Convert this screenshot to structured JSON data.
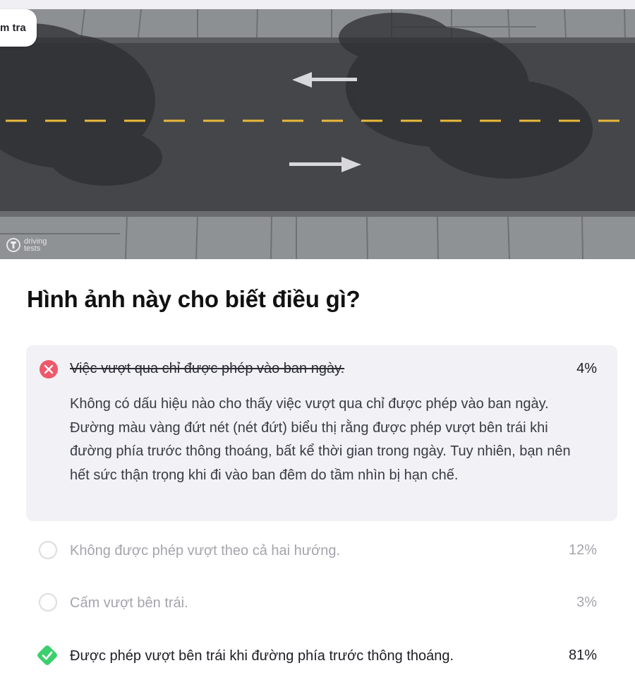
{
  "header": {
    "tab_label": "m tra"
  },
  "illustration": {
    "watermark_line1": "driving",
    "watermark_line2": "tests"
  },
  "question": {
    "text": "Hình ảnh này cho biết điều gì?"
  },
  "options": [
    {
      "label": "Việc vượt qua chỉ được phép vào ban ngày.",
      "percent": "4%",
      "state": "incorrect-selected",
      "icon": "x-circle-icon",
      "explanation": "Không có dấu hiệu nào cho thấy việc vượt qua chỉ được phép vào ban ngày. Đường màu vàng đứt nét (nét đứt) biểu thị rằng được phép vượt bên trái khi đường phía trước thông thoáng, bất kể thời gian trong ngày. Tuy nhiên, bạn nên hết sức thận trọng khi đi vào ban đêm do tầm nhìn bị hạn chế."
    },
    {
      "label": "Không được phép vượt theo cả hai hướng.",
      "percent": "12%",
      "state": "unselected",
      "icon": "radio-empty-icon"
    },
    {
      "label": "Cấm vượt bên trái.",
      "percent": "3%",
      "state": "unselected",
      "icon": "radio-empty-icon"
    },
    {
      "label": "Được phép vượt bên trái khi đường phía trước thông thoáng.",
      "percent": "81%",
      "state": "correct",
      "icon": "check-diamond-icon"
    }
  ],
  "colors": {
    "incorrect": "#f0576a",
    "correct": "#3ccf6e",
    "card_bg": "#f1f1f6",
    "lane_line": "#e8b93a"
  }
}
